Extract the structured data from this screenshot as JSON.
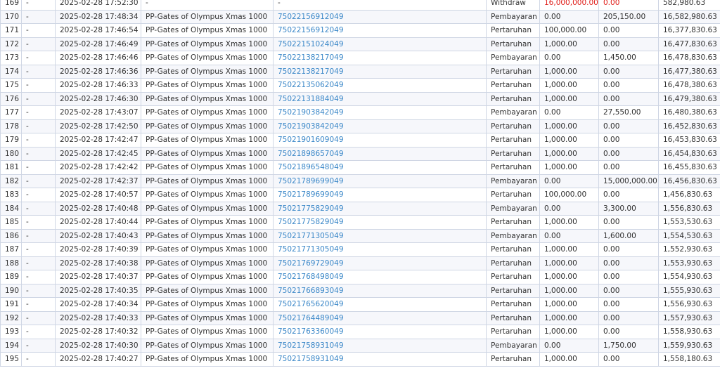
{
  "rows": [
    {
      "no": "169",
      "c2": "-",
      "date": "2025-02-28 17:52:30",
      "game": "-",
      "ref": "-",
      "ref_link": false,
      "type": "Withdraw",
      "debit": "16,000,000.00",
      "credit": "0.00",
      "balance": "582,980.63",
      "highlight": true
    },
    {
      "no": "170",
      "c2": "-",
      "date": "2025-02-28 17:48:34",
      "game": "PP-Gates of Olympus Xmas 1000",
      "ref": "75022156912049",
      "ref_link": true,
      "type": "Pembayaran",
      "debit": "0.00",
      "credit": "205,150.00",
      "balance": "16,582,980.63"
    },
    {
      "no": "171",
      "c2": "-",
      "date": "2025-02-28 17:46:54",
      "game": "PP-Gates of Olympus Xmas 1000",
      "ref": "75022156912049",
      "ref_link": true,
      "type": "Pertaruhan",
      "debit": "100,000.00",
      "credit": "0.00",
      "balance": "16,377,830.63"
    },
    {
      "no": "172",
      "c2": "-",
      "date": "2025-02-28 17:46:49",
      "game": "PP-Gates of Olympus Xmas 1000",
      "ref": "75022151024049",
      "ref_link": true,
      "type": "Pertaruhan",
      "debit": "1,000.00",
      "credit": "0.00",
      "balance": "16,477,830.63"
    },
    {
      "no": "173",
      "c2": "-",
      "date": "2025-02-28 17:46:46",
      "game": "PP-Gates of Olympus Xmas 1000",
      "ref": "75022138217049",
      "ref_link": true,
      "type": "Pembayaran",
      "debit": "0.00",
      "credit": "1,450.00",
      "balance": "16,478,830.63"
    },
    {
      "no": "174",
      "c2": "-",
      "date": "2025-02-28 17:46:36",
      "game": "PP-Gates of Olympus Xmas 1000",
      "ref": "75022138217049",
      "ref_link": true,
      "type": "Pertaruhan",
      "debit": "1,000.00",
      "credit": "0.00",
      "balance": "16,477,380.63"
    },
    {
      "no": "175",
      "c2": "-",
      "date": "2025-02-28 17:46:33",
      "game": "PP-Gates of Olympus Xmas 1000",
      "ref": "75022135062049",
      "ref_link": true,
      "type": "Pertaruhan",
      "debit": "1,000.00",
      "credit": "0.00",
      "balance": "16,478,380.63"
    },
    {
      "no": "176",
      "c2": "-",
      "date": "2025-02-28 17:46:30",
      "game": "PP-Gates of Olympus Xmas 1000",
      "ref": "75022131884049",
      "ref_link": true,
      "type": "Pertaruhan",
      "debit": "1,000.00",
      "credit": "0.00",
      "balance": "16,479,380.63"
    },
    {
      "no": "177",
      "c2": "-",
      "date": "2025-02-28 17:43:07",
      "game": "PP-Gates of Olympus Xmas 1000",
      "ref": "75021903842049",
      "ref_link": true,
      "type": "Pembayaran",
      "debit": "0.00",
      "credit": "27,550.00",
      "balance": "16,480,380.63"
    },
    {
      "no": "178",
      "c2": "-",
      "date": "2025-02-28 17:42:50",
      "game": "PP-Gates of Olympus Xmas 1000",
      "ref": "75021903842049",
      "ref_link": true,
      "type": "Pertaruhan",
      "debit": "1,000.00",
      "credit": "0.00",
      "balance": "16,452,830.63"
    },
    {
      "no": "179",
      "c2": "-",
      "date": "2025-02-28 17:42:47",
      "game": "PP-Gates of Olympus Xmas 1000",
      "ref": "75021901609049",
      "ref_link": true,
      "type": "Pertaruhan",
      "debit": "1,000.00",
      "credit": "0.00",
      "balance": "16,453,830.63"
    },
    {
      "no": "180",
      "c2": "-",
      "date": "2025-02-28 17:42:45",
      "game": "PP-Gates of Olympus Xmas 1000",
      "ref": "75021898657049",
      "ref_link": true,
      "type": "Pertaruhan",
      "debit": "1,000.00",
      "credit": "0.00",
      "balance": "16,454,830.63"
    },
    {
      "no": "181",
      "c2": "-",
      "date": "2025-02-28 17:42:42",
      "game": "PP-Gates of Olympus Xmas 1000",
      "ref": "75021896548049",
      "ref_link": true,
      "type": "Pertaruhan",
      "debit": "1,000.00",
      "credit": "0.00",
      "balance": "16,455,830.63"
    },
    {
      "no": "182",
      "c2": "-",
      "date": "2025-02-28 17:42:37",
      "game": "PP-Gates of Olympus Xmas 1000",
      "ref": "75021789699049",
      "ref_link": true,
      "type": "Pembayaran",
      "debit": "0.00",
      "credit": "15,000,000.00",
      "balance": "16,456,830.63"
    },
    {
      "no": "183",
      "c2": "-",
      "date": "2025-02-28 17:40:57",
      "game": "PP-Gates of Olympus Xmas 1000",
      "ref": "75021789699049",
      "ref_link": true,
      "type": "Pertaruhan",
      "debit": "100,000.00",
      "credit": "0.00",
      "balance": "1,456,830.63"
    },
    {
      "no": "184",
      "c2": "-",
      "date": "2025-02-28 17:40:48",
      "game": "PP-Gates of Olympus Xmas 1000",
      "ref": "75021775829049",
      "ref_link": true,
      "type": "Pembayaran",
      "debit": "0.00",
      "credit": "3,300.00",
      "balance": "1,556,830.63"
    },
    {
      "no": "185",
      "c2": "-",
      "date": "2025-02-28 17:40:44",
      "game": "PP-Gates of Olympus Xmas 1000",
      "ref": "75021775829049",
      "ref_link": true,
      "type": "Pertaruhan",
      "debit": "1,000.00",
      "credit": "0.00",
      "balance": "1,553,530.63"
    },
    {
      "no": "186",
      "c2": "-",
      "date": "2025-02-28 17:40:43",
      "game": "PP-Gates of Olympus Xmas 1000",
      "ref": "75021771305049",
      "ref_link": true,
      "type": "Pembayaran",
      "debit": "0.00",
      "credit": "1,600.00",
      "balance": "1,554,530.63"
    },
    {
      "no": "187",
      "c2": "-",
      "date": "2025-02-28 17:40:39",
      "game": "PP-Gates of Olympus Xmas 1000",
      "ref": "75021771305049",
      "ref_link": true,
      "type": "Pertaruhan",
      "debit": "1,000.00",
      "credit": "0.00",
      "balance": "1,552,930.63"
    },
    {
      "no": "188",
      "c2": "-",
      "date": "2025-02-28 17:40:38",
      "game": "PP-Gates of Olympus Xmas 1000",
      "ref": "75021769729049",
      "ref_link": true,
      "type": "Pertaruhan",
      "debit": "1,000.00",
      "credit": "0.00",
      "balance": "1,553,930.63"
    },
    {
      "no": "189",
      "c2": "-",
      "date": "2025-02-28 17:40:37",
      "game": "PP-Gates of Olympus Xmas 1000",
      "ref": "75021768498049",
      "ref_link": true,
      "type": "Pertaruhan",
      "debit": "1,000.00",
      "credit": "0.00",
      "balance": "1,554,930.63"
    },
    {
      "no": "190",
      "c2": "-",
      "date": "2025-02-28 17:40:35",
      "game": "PP-Gates of Olympus Xmas 1000",
      "ref": "75021766893049",
      "ref_link": true,
      "type": "Pertaruhan",
      "debit": "1,000.00",
      "credit": "0.00",
      "balance": "1,555,930.63"
    },
    {
      "no": "191",
      "c2": "-",
      "date": "2025-02-28 17:40:34",
      "game": "PP-Gates of Olympus Xmas 1000",
      "ref": "75021765620049",
      "ref_link": true,
      "type": "Pertaruhan",
      "debit": "1,000.00",
      "credit": "0.00",
      "balance": "1,556,930.63"
    },
    {
      "no": "192",
      "c2": "-",
      "date": "2025-02-28 17:40:33",
      "game": "PP-Gates of Olympus Xmas 1000",
      "ref": "75021764489049",
      "ref_link": true,
      "type": "Pertaruhan",
      "debit": "1,000.00",
      "credit": "0.00",
      "balance": "1,557,930.63"
    },
    {
      "no": "193",
      "c2": "-",
      "date": "2025-02-28 17:40:32",
      "game": "PP-Gates of Olympus Xmas 1000",
      "ref": "75021763360049",
      "ref_link": true,
      "type": "Pertaruhan",
      "debit": "1,000.00",
      "credit": "0.00",
      "balance": "1,558,930.63"
    },
    {
      "no": "194",
      "c2": "-",
      "date": "2025-02-28 17:40:30",
      "game": "PP-Gates of Olympus Xmas 1000",
      "ref": "75021758931049",
      "ref_link": true,
      "type": "Pembayaran",
      "debit": "0.00",
      "credit": "1,750.00",
      "balance": "1,559,930.63"
    },
    {
      "no": "195",
      "c2": "-",
      "date": "2025-02-28 17:40:27",
      "game": "PP-Gates of Olympus Xmas 1000",
      "ref": "75021758931049",
      "ref_link": true,
      "type": "Pertaruhan",
      "debit": "1,000.00",
      "credit": "0.00",
      "balance": "1,558,180.63"
    }
  ],
  "colors": {
    "link": "#3a87c8",
    "alert": "#e0201b",
    "border": "#cfd6e4",
    "row_alt": "#f6f7fb"
  }
}
